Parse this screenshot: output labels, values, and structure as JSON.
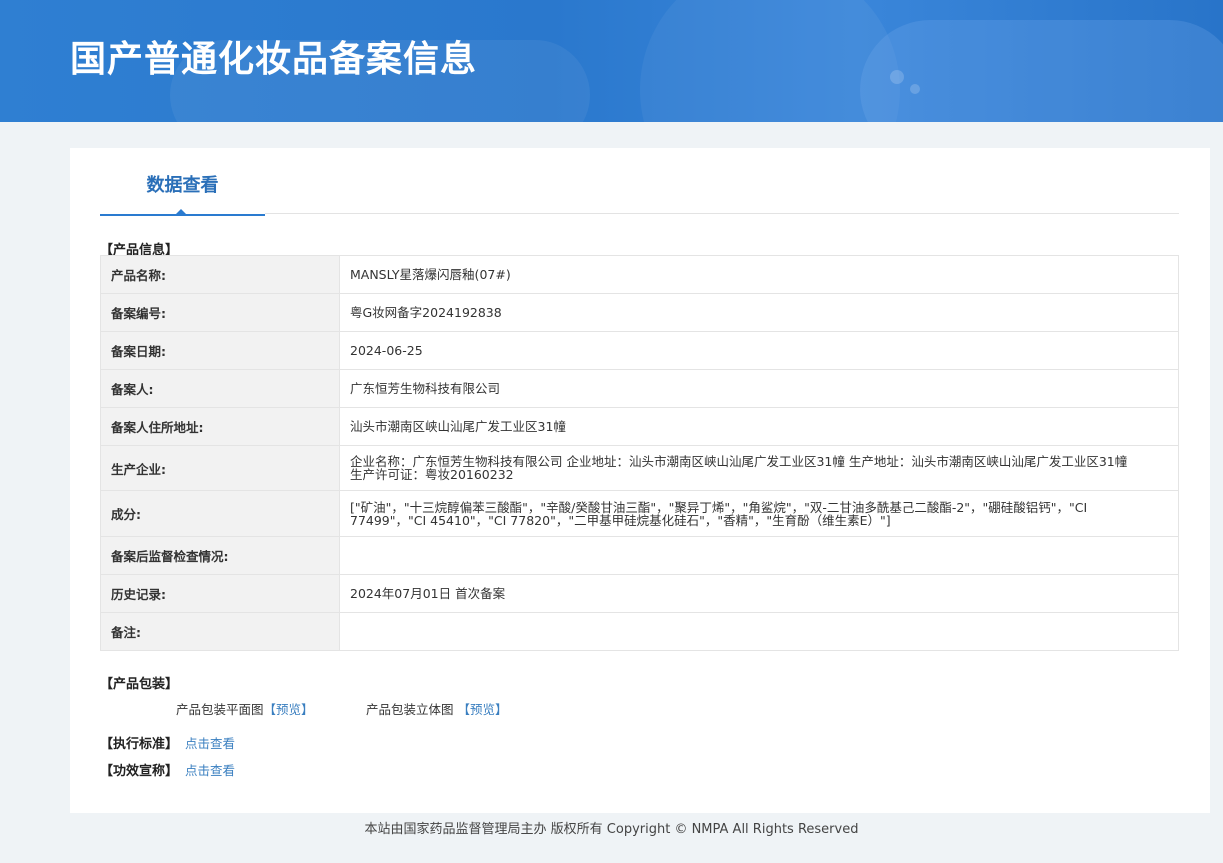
{
  "header": {
    "title": "国产普通化妆品备案信息"
  },
  "tab": {
    "label": "数据查看"
  },
  "product_info": {
    "section_title": "【产品信息】",
    "rows": [
      {
        "label": "产品名称:",
        "value": "MANSLY星落爆闪唇釉(07#)"
      },
      {
        "label": "备案编号:",
        "value": "粤G妆网备字2024192838"
      },
      {
        "label": "备案日期:",
        "value": "2024-06-25"
      },
      {
        "label": "备案人:",
        "value": "广东恒芳生物科技有限公司"
      },
      {
        "label": "备案人住所地址:",
        "value": "汕头市潮南区峡山汕尾广发工业区31幢"
      },
      {
        "label": "生产企业:",
        "value": "企业名称：广东恒芳生物科技有限公司 企业地址：汕头市潮南区峡山汕尾广发工业区31幢 生产地址：汕头市潮南区峡山汕尾广发工业区31幢 生产许可证：粤妆20160232"
      },
      {
        "label": "成分:",
        "value": "[\"矿油\"，\"十三烷醇偏苯三酸酯\"，\"辛酸/癸酸甘油三酯\"，\"聚异丁烯\"，\"角鲨烷\"，\"双-二甘油多酰基己二酸酯-2\"，\"硼硅酸铝钙\"，\"CI 77499\"，\"CI 45410\"，\"CI 77820\"，\"二甲基甲硅烷基化硅石\"，\"香精\"，\"生育酚（维生素E）\"]"
      },
      {
        "label": "备案后监督检查情况:",
        "value": ""
      },
      {
        "label": "历史记录:",
        "value": "2024年07月01日 首次备案"
      },
      {
        "label": "备注:",
        "value": ""
      }
    ]
  },
  "packaging": {
    "section_title": "【产品包装】",
    "flat_label": "产品包装平面图",
    "flat_link": "【预览】",
    "solid_label": "产品包装立体图 ",
    "solid_link": "【预览】"
  },
  "standard": {
    "section_title": "【执行标准】",
    "link": "点击查看"
  },
  "efficacy": {
    "section_title": "【功效宣称】",
    "link": "点击查看"
  },
  "footer": {
    "text": "本站由国家药品监督管理局主办 版权所有 Copyright © NMPA All Rights Reserved"
  }
}
